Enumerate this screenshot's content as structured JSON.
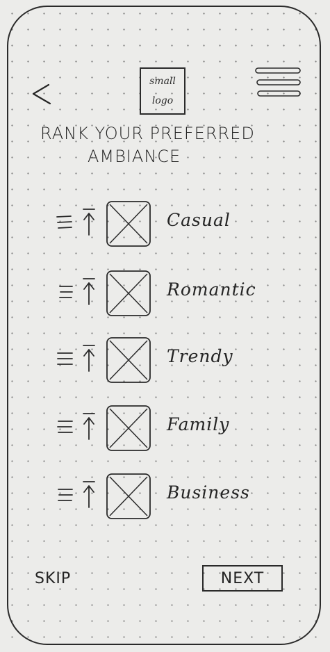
{
  "header": {
    "logo_line1": "small",
    "logo_line2": "logo"
  },
  "title": {
    "line1": "RANK YOUR PREFERRED",
    "line2": "AMBIANCE"
  },
  "items": [
    {
      "label": "Casual"
    },
    {
      "label": "Romantic"
    },
    {
      "label": "Trendy"
    },
    {
      "label": "Family"
    },
    {
      "label": "Business"
    }
  ],
  "footer": {
    "skip_label": "SKIP",
    "next_label": "NEXT"
  },
  "icons": {
    "back": "chevron-left-icon",
    "menu": "hamburger-menu-icon",
    "drag": "drag-handle-icon",
    "move_up": "move-to-top-icon",
    "image": "image-placeholder-icon"
  }
}
